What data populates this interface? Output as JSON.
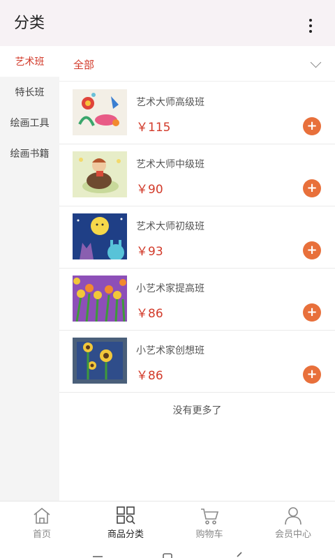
{
  "header": {
    "title": "分类"
  },
  "sidebar": {
    "items": [
      {
        "label": "艺术班"
      },
      {
        "label": "特长班"
      },
      {
        "label": "绘画工具"
      },
      {
        "label": "绘画书籍"
      }
    ]
  },
  "filter": {
    "label": "全部"
  },
  "products": [
    {
      "name": "艺术大师高级班",
      "price": "￥115"
    },
    {
      "name": "艺术大师中级班",
      "price": "￥90"
    },
    {
      "name": "艺术大师初级班",
      "price": "￥93"
    },
    {
      "name": "小艺术家提高班",
      "price": "￥86"
    },
    {
      "name": "小艺术家创想班",
      "price": "￥86"
    }
  ],
  "list_footer": "没有更多了",
  "tabbar": {
    "items": [
      {
        "label": "首页",
        "icon": "home-icon"
      },
      {
        "label": "商品分类",
        "icon": "category-icon"
      },
      {
        "label": "购物车",
        "icon": "cart-icon"
      },
      {
        "label": "会员中心",
        "icon": "user-icon"
      }
    ]
  },
  "colors": {
    "accent": "#d23a2a",
    "add_button": "#e8703b"
  }
}
